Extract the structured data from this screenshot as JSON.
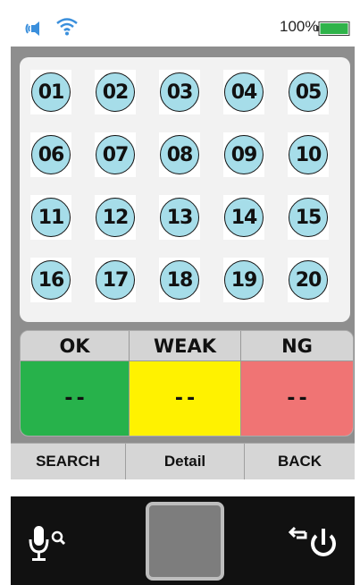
{
  "status_bar": {
    "battery_percent_text": "100%",
    "battery_level": 1.0,
    "icons": [
      "volume-icon",
      "wifi-icon",
      "battery-icon"
    ],
    "accent_color": "#2fb34a"
  },
  "grid": {
    "balls": [
      "01",
      "02",
      "03",
      "04",
      "05",
      "06",
      "07",
      "08",
      "09",
      "10",
      "11",
      "12",
      "13",
      "14",
      "15",
      "16",
      "17",
      "18",
      "19",
      "20"
    ],
    "ball_color": "#a6dde9"
  },
  "results": {
    "ok": {
      "label": "OK",
      "value": "--",
      "color": "#27b24b"
    },
    "weak": {
      "label": "WEAK",
      "value": "--",
      "color": "#fff200"
    },
    "ng": {
      "label": "NG",
      "value": "--",
      "color": "#f07474"
    }
  },
  "buttons": {
    "search": "SEARCH",
    "detail": "Detail",
    "back": "BACK"
  },
  "nav": {
    "icons": [
      "voice-search-icon",
      "home-square-icon",
      "back-power-icon"
    ]
  }
}
